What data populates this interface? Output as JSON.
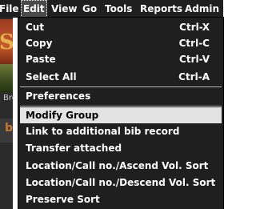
{
  "menubar": {
    "items": [
      "File",
      "Edit",
      "View",
      "Go",
      "Tools",
      "Reports",
      "Admin"
    ],
    "active": "Edit"
  },
  "background": {
    "label": "Bro"
  },
  "edit_menu": {
    "group1": [
      {
        "label": "Cut",
        "shortcut": "Ctrl-X"
      },
      {
        "label": "Copy",
        "shortcut": "Ctrl-C"
      },
      {
        "label": "Paste",
        "shortcut": "Ctrl-V"
      },
      {
        "label": "Select All",
        "shortcut": "Ctrl-A"
      }
    ],
    "group2": [
      {
        "label": "Preferences"
      }
    ],
    "group3": [
      {
        "label": "Modify Group",
        "highlighted": true
      },
      {
        "label": "Link to additional bib record"
      },
      {
        "label": "Transfer attached"
      },
      {
        "label": "Location/Call no./Ascend Vol. Sort"
      },
      {
        "label": "Location/Call no./Descend Vol. Sort"
      },
      {
        "label": "Preserve Sort"
      }
    ]
  },
  "colors": {
    "menu_background": "#1f1f1f",
    "menu_text": "#ffffff",
    "highlight_background": "#e3e3e3",
    "highlight_text": "#000000"
  }
}
